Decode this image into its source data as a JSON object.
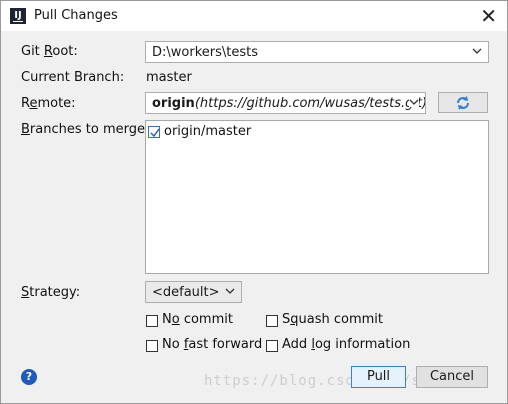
{
  "window": {
    "title": "Pull Changes",
    "icon": "intellij-idea-icon"
  },
  "labels": {
    "git_root_pre": "Git ",
    "git_root_u": "R",
    "git_root_post": "oot:",
    "current_branch": "Current Branch:",
    "remote_pre": "R",
    "remote_u": "e",
    "remote_post": "mote:",
    "branches_u": "B",
    "branches_post": "ranches to merge:",
    "strategy_u": "S",
    "strategy_post": "trategy:"
  },
  "git_root": {
    "value": "D:\\workers\\tests"
  },
  "current_branch": {
    "value": "master"
  },
  "remote": {
    "name": "origin",
    "url": "(https://github.com/wusas/tests.git)"
  },
  "branches": [
    {
      "label": "origin/master",
      "checked": true
    }
  ],
  "strategy": {
    "value": "<default>"
  },
  "options": {
    "no_commit": {
      "pre": "N",
      "u": "o",
      "post": " commit",
      "checked": false
    },
    "squash_commit": {
      "pre": "S",
      "u": "q",
      "post": "uash commit",
      "checked": false
    },
    "no_fast_forward": {
      "pre": "No ",
      "u": "f",
      "post": "ast forward",
      "checked": false
    },
    "add_log_information": {
      "pre": "Add ",
      "u": "l",
      "post": "og information",
      "checked": false
    }
  },
  "buttons": {
    "pull": "Pull",
    "cancel": "Cancel"
  },
  "watermark": "https://blog.csdn.net/shal024"
}
